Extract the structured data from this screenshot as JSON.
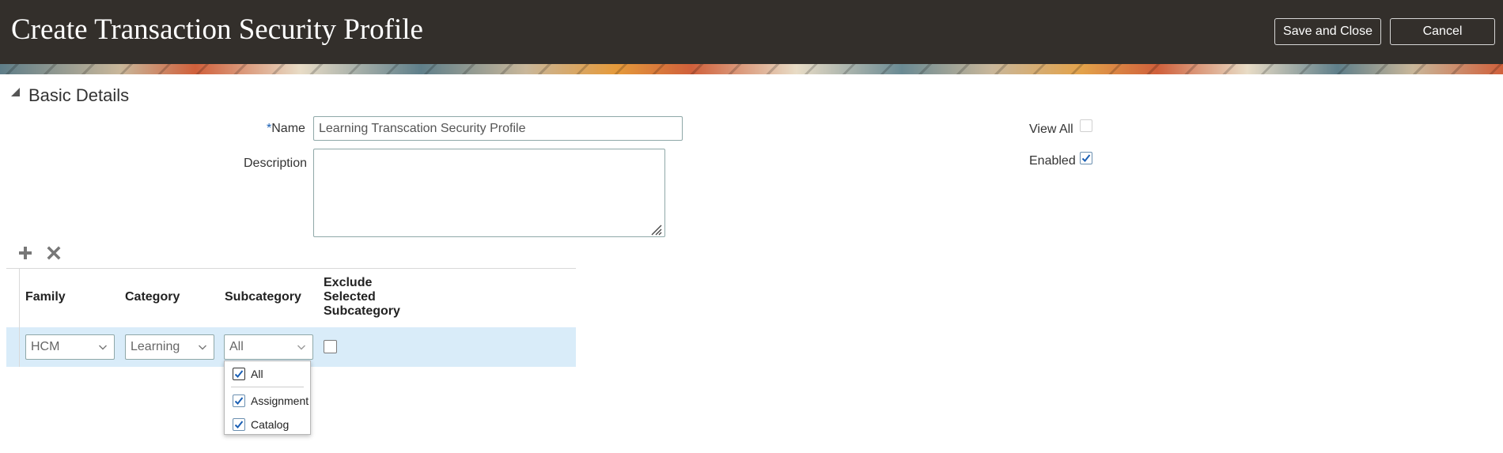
{
  "header": {
    "title": "Create Transaction Security Profile",
    "save_close_label": "Save and Close",
    "cancel_label": "Cancel"
  },
  "section": {
    "title": "Basic Details"
  },
  "form": {
    "name_required_marker": "*",
    "name_label": "Name",
    "name_value": "Learning Transcation Security Profile",
    "description_label": "Description",
    "description_value": "",
    "view_all_label": "View All",
    "view_all_checked": false,
    "enabled_label": "Enabled",
    "enabled_checked": true
  },
  "table": {
    "toolbar": {
      "add_icon": "plus-icon",
      "delete_icon": "x-icon"
    },
    "columns": [
      "Family",
      "Category",
      "Subcategory",
      "Exclude Selected Subcategory"
    ],
    "exclude_header_lines": [
      "Exclude",
      "Selected",
      "Subcategory"
    ],
    "rows": [
      {
        "family": "HCM",
        "category": "Learning",
        "subcategory": "All",
        "exclude_selected": false
      }
    ]
  },
  "subcategory_dropdown": {
    "options": [
      {
        "label": "All",
        "checked": true
      },
      {
        "label": "Assignment",
        "checked": true
      },
      {
        "label": "Catalog",
        "checked": true
      }
    ]
  },
  "colors": {
    "header_bg": "#332f2b",
    "selected_row_bg": "#d9ecf9",
    "checkmark": "#1a5fb4"
  }
}
